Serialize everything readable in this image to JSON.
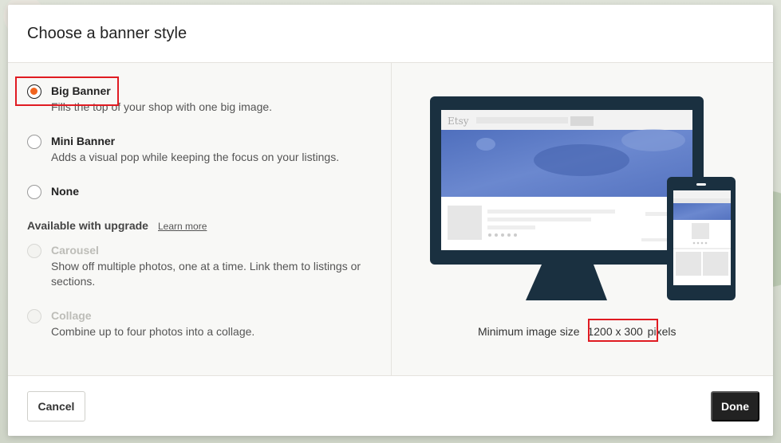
{
  "dialog": {
    "title": "Choose a banner style"
  },
  "options": {
    "big_banner": {
      "label": "Big Banner",
      "desc": "Fills the top of your shop with one big image.",
      "selected": true
    },
    "mini_banner": {
      "label": "Mini Banner",
      "desc": "Adds a visual pop while keeping the focus on your listings.",
      "selected": false
    },
    "none": {
      "label": "None",
      "selected": false
    }
  },
  "upgrade": {
    "heading": "Available with upgrade",
    "learn_more": "Learn more",
    "carousel": {
      "label": "Carousel",
      "desc": "Show off multiple photos, one at a time. Link them to listings or sections.",
      "disabled": true
    },
    "collage": {
      "label": "Collage",
      "desc": "Combine up to four photos into a collage.",
      "disabled": true
    }
  },
  "preview": {
    "brand": "Etsy",
    "min_size_prefix": "Minimum image size",
    "min_size_value": "1200 x 300",
    "min_size_suffix": "pixels"
  },
  "footer": {
    "cancel_label": "Cancel",
    "done_label": "Done"
  },
  "colors": {
    "accent_radio": "#f1641e",
    "annotation_red": "#e01b22",
    "device_dark": "#1a3040",
    "banner_blue": "#5b79c4",
    "done_button": "#222222"
  }
}
